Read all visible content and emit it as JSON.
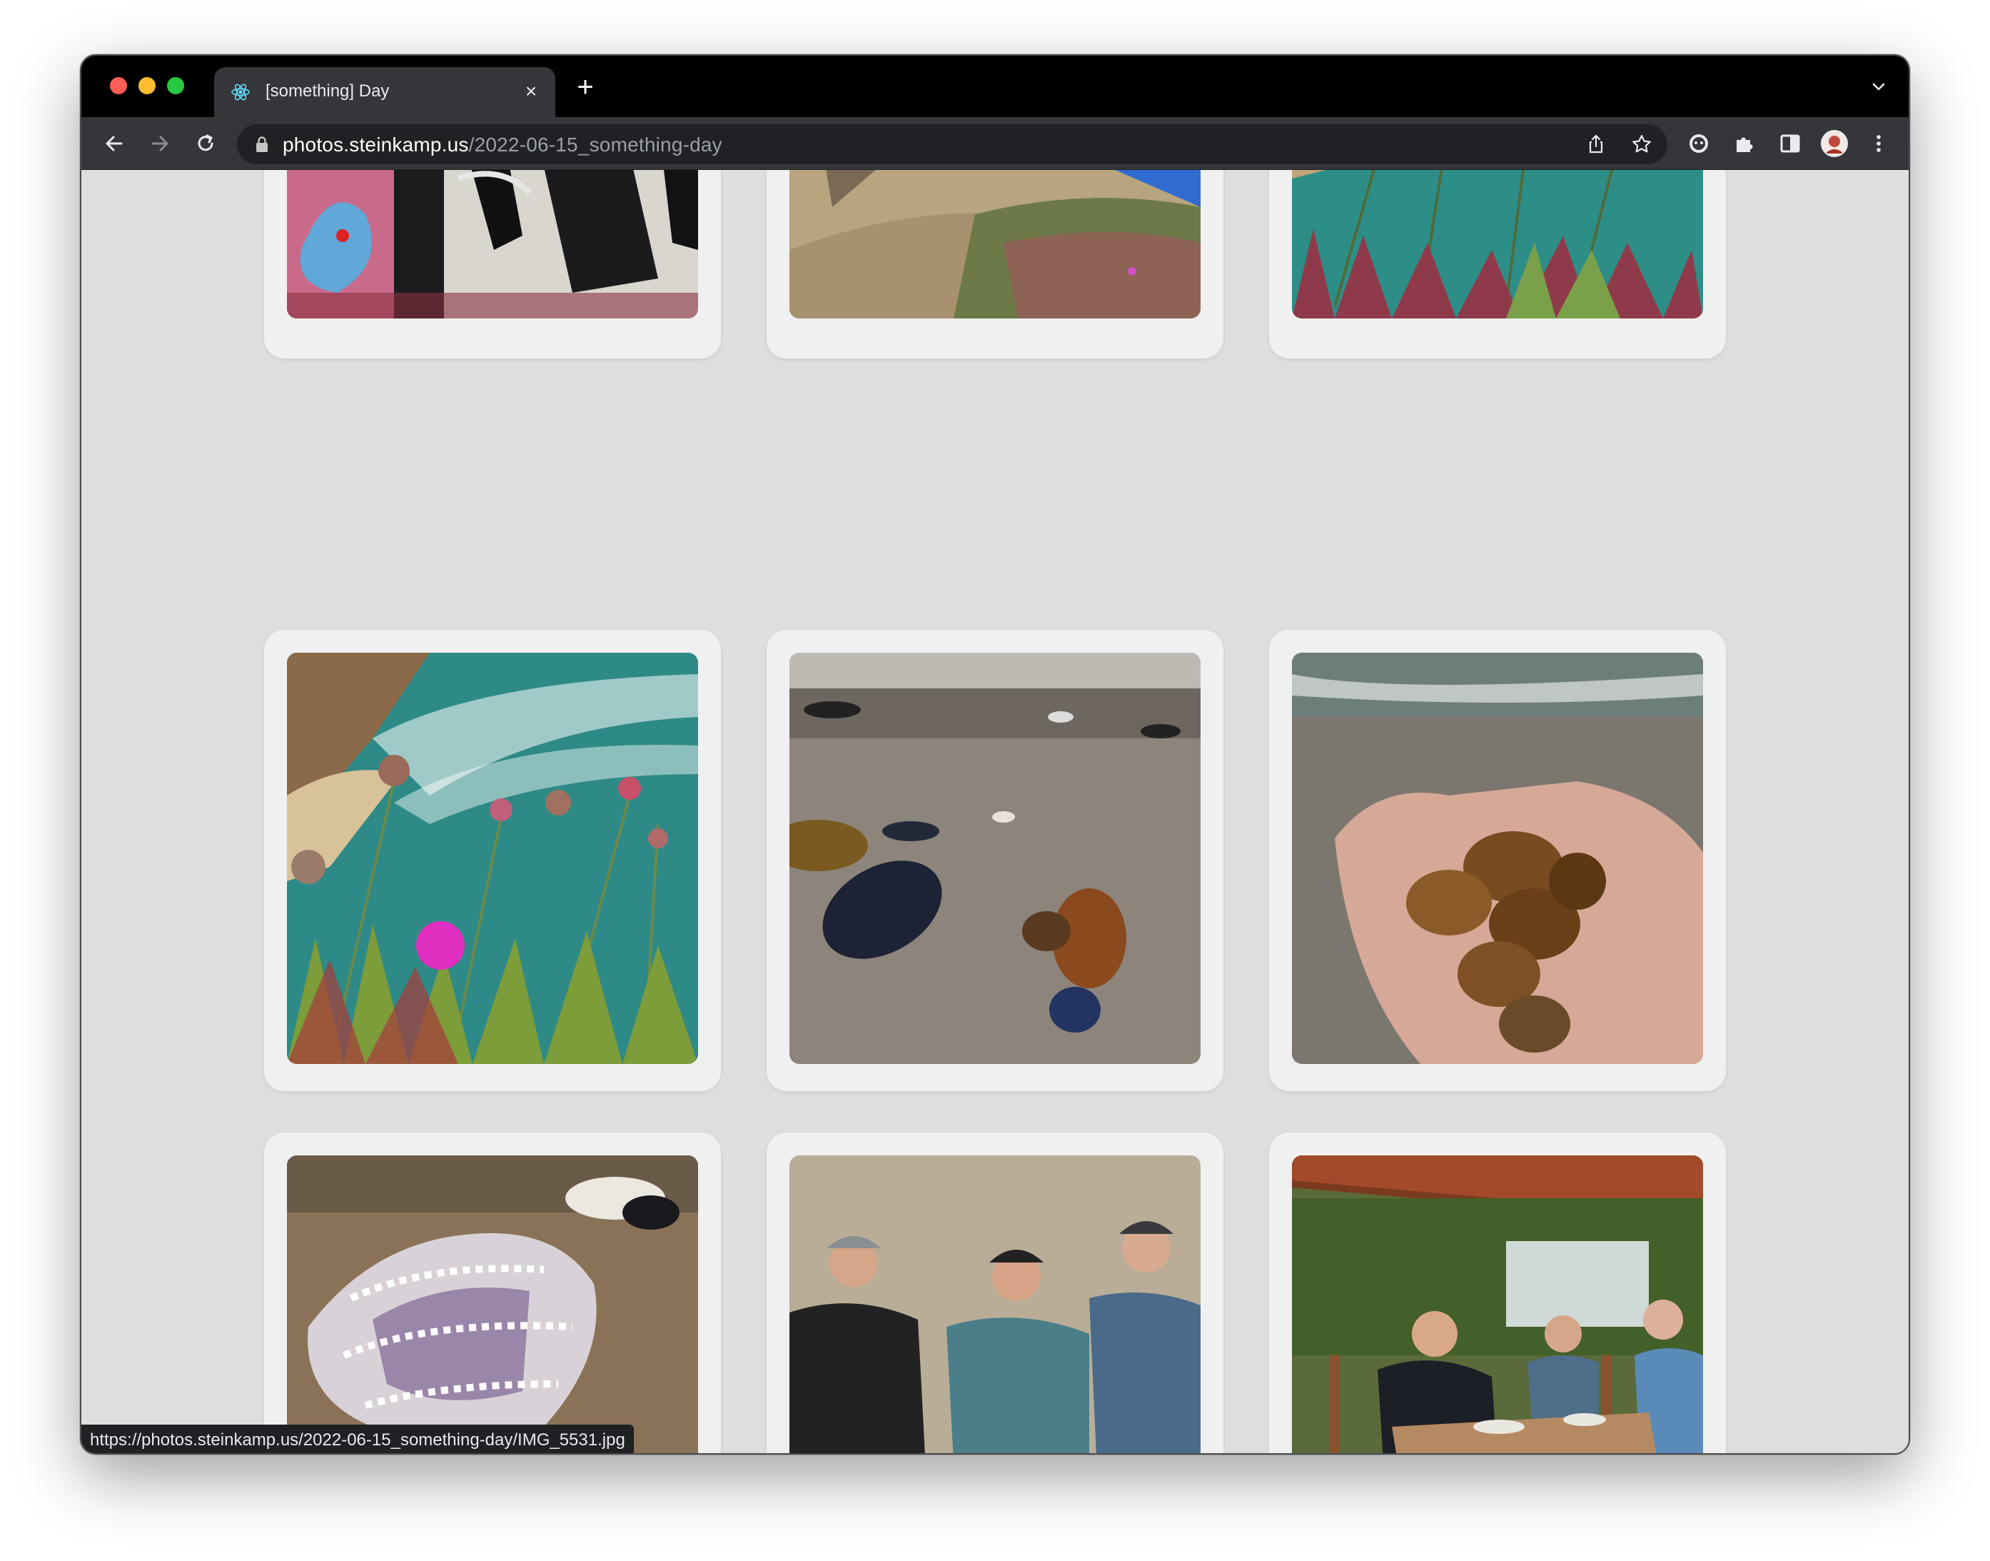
{
  "browser": {
    "tab": {
      "title": "[something] Day",
      "favicon": "react-atom-icon"
    },
    "new_tab_label": "+",
    "close_tab_label": "×",
    "address": {
      "host": "photos.steinkamp.us",
      "path": "/2022-06-15_something-day"
    },
    "status_url": "https://photos.steinkamp.us/2022-06-15_something-day/IMG_5531.jpg"
  },
  "gallery": {
    "photos": [
      {
        "subject": "graffiti-wall"
      },
      {
        "subject": "graffiti-bunker-on-cliff"
      },
      {
        "subject": "sea-pinks-over-ocean"
      },
      {
        "subject": "thrift-flowers-and-ice-plant"
      },
      {
        "subject": "mussel-shells-on-sand"
      },
      {
        "subject": "snail-shells-in-hand"
      },
      {
        "subject": "sea-urchin-shell"
      },
      {
        "subject": "three-hikers-on-beach"
      },
      {
        "subject": "lunch-under-pergola"
      }
    ]
  },
  "colors": {
    "tab_active": "#35363a",
    "tabstrip": "#000000",
    "page_background": "#dedede",
    "card_background": "#f0f0f0"
  }
}
